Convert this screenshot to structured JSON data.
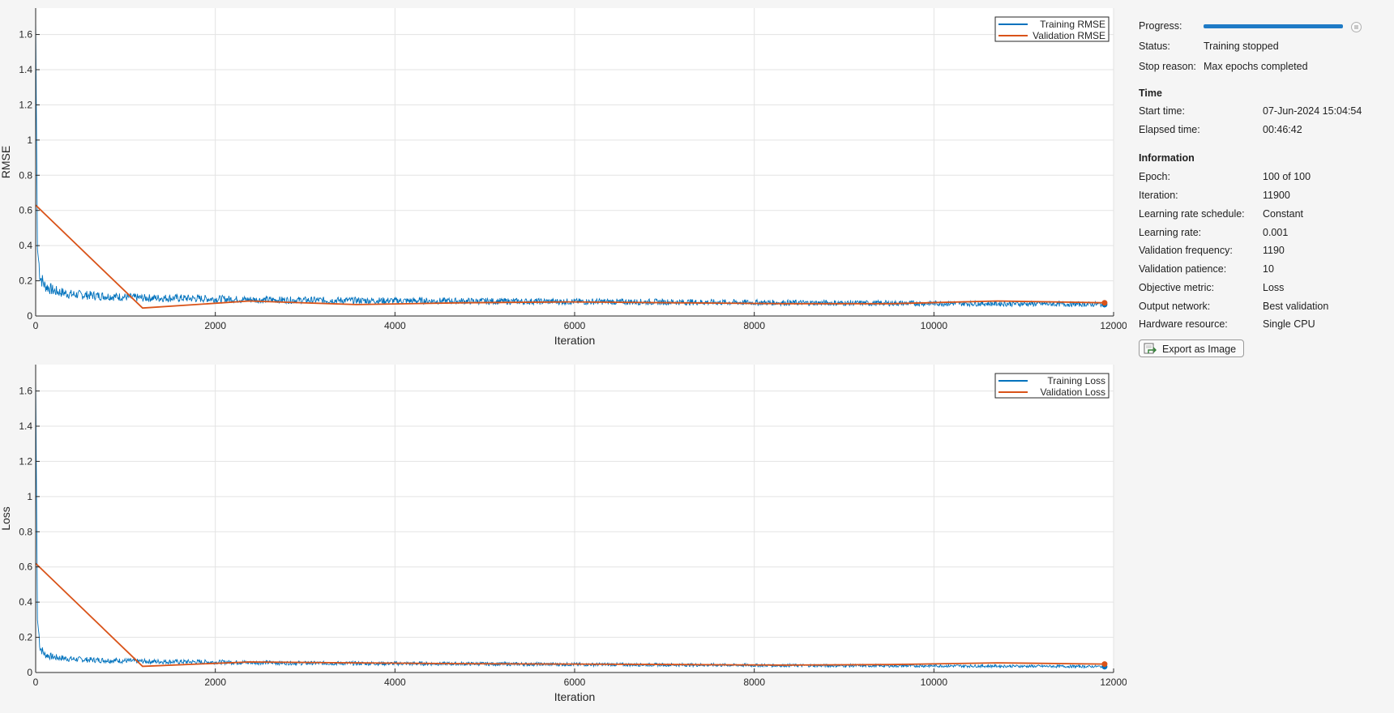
{
  "chart_data": [
    {
      "type": "line",
      "xlabel": "Iteration",
      "ylabel": "RMSE",
      "xlim": [
        0,
        12000
      ],
      "ylim": [
        0,
        1.75
      ],
      "x_ticks": [
        0,
        2000,
        4000,
        6000,
        8000,
        10000,
        12000
      ],
      "x_tick_labels": [
        "0",
        "2000",
        "4000",
        "6000",
        "8000",
        "10000",
        "12000"
      ],
      "y_ticks": [
        0,
        0.2,
        0.4,
        0.6,
        0.8,
        1,
        1.2,
        1.4,
        1.6
      ],
      "y_tick_labels": [
        "0",
        "0.2",
        "0.4",
        "0.6",
        "0.8",
        "1",
        "1.2",
        "1.4",
        "1.6"
      ],
      "grid": true,
      "legend_position": "top-right",
      "series": [
        {
          "name": "Training RMSE",
          "color": "#0072bd",
          "x": [
            0,
            20,
            50,
            100,
            200,
            400,
            600,
            800,
            1000,
            1200,
            1500,
            2000,
            2500,
            3000,
            4000,
            5000,
            6000,
            7000,
            8000,
            9000,
            10000,
            11000,
            11900
          ],
          "y": [
            1.7,
            0.38,
            0.22,
            0.17,
            0.14,
            0.12,
            0.115,
            0.11,
            0.105,
            0.1,
            0.1,
            0.095,
            0.09,
            0.088,
            0.085,
            0.082,
            0.08,
            0.078,
            0.075,
            0.072,
            0.07,
            0.068,
            0.065
          ]
        },
        {
          "name": "Validation RMSE",
          "color": "#d95319",
          "x": [
            0,
            1190,
            2380,
            3570,
            4760,
            5950,
            7140,
            8330,
            9520,
            10710,
            11900
          ],
          "y": [
            0.63,
            0.045,
            0.085,
            0.065,
            0.075,
            0.08,
            0.075,
            0.07,
            0.07,
            0.085,
            0.075
          ]
        }
      ]
    },
    {
      "type": "line",
      "xlabel": "Iteration",
      "ylabel": "Loss",
      "xlim": [
        0,
        12000
      ],
      "ylim": [
        0,
        1.75
      ],
      "x_ticks": [
        0,
        2000,
        4000,
        6000,
        8000,
        10000,
        12000
      ],
      "x_tick_labels": [
        "0",
        "2000",
        "4000",
        "6000",
        "8000",
        "10000",
        "12000"
      ],
      "y_ticks": [
        0,
        0.2,
        0.4,
        0.6,
        0.8,
        1,
        1.2,
        1.4,
        1.6
      ],
      "y_tick_labels": [
        "0",
        "0.2",
        "0.4",
        "0.6",
        "0.8",
        "1",
        "1.2",
        "1.4",
        "1.6"
      ],
      "grid": true,
      "legend_position": "top-right",
      "series": [
        {
          "name": "Training Loss",
          "color": "#0072bd",
          "x": [
            0,
            20,
            50,
            100,
            200,
            400,
            600,
            800,
            1000,
            1200,
            1500,
            2000,
            2500,
            3000,
            4000,
            5000,
            6000,
            7000,
            8000,
            9000,
            10000,
            11000,
            11900
          ],
          "y": [
            1.7,
            0.3,
            0.14,
            0.1,
            0.085,
            0.075,
            0.07,
            0.068,
            0.065,
            0.062,
            0.06,
            0.058,
            0.055,
            0.052,
            0.05,
            0.048,
            0.045,
            0.043,
            0.04,
            0.038,
            0.037,
            0.035,
            0.033
          ]
        },
        {
          "name": "Validation Loss",
          "color": "#d95319",
          "x": [
            0,
            1190,
            2380,
            3570,
            4760,
            5950,
            7140,
            8330,
            9520,
            10710,
            11900
          ],
          "y": [
            0.62,
            0.035,
            0.06,
            0.055,
            0.05,
            0.048,
            0.045,
            0.042,
            0.045,
            0.055,
            0.048
          ]
        }
      ]
    }
  ],
  "panel": {
    "progress": {
      "label": "Progress:",
      "fraction": 1.0
    },
    "status": {
      "label": "Status:",
      "value": "Training stopped"
    },
    "stop_reason": {
      "label": "Stop reason:",
      "value": "Max epochs completed"
    },
    "time_heading": "Time",
    "time": [
      {
        "label": "Start time:",
        "value": "07-Jun-2024 15:04:54"
      },
      {
        "label": "Elapsed time:",
        "value": "00:46:42"
      }
    ],
    "info_heading": "Information",
    "info": [
      {
        "label": "Epoch:",
        "value": "100 of 100"
      },
      {
        "label": "Iteration:",
        "value": "11900"
      },
      {
        "label": "Learning rate schedule:",
        "value": "Constant"
      },
      {
        "label": "Learning rate:",
        "value": "0.001"
      },
      {
        "label": "Validation frequency:",
        "value": "1190"
      },
      {
        "label": "Validation patience:",
        "value": "10"
      },
      {
        "label": "Objective metric:",
        "value": "Loss"
      },
      {
        "label": "Output network:",
        "value": "Best validation"
      },
      {
        "label": "Hardware resource:",
        "value": "Single CPU"
      }
    ],
    "export_label": "Export as Image"
  }
}
